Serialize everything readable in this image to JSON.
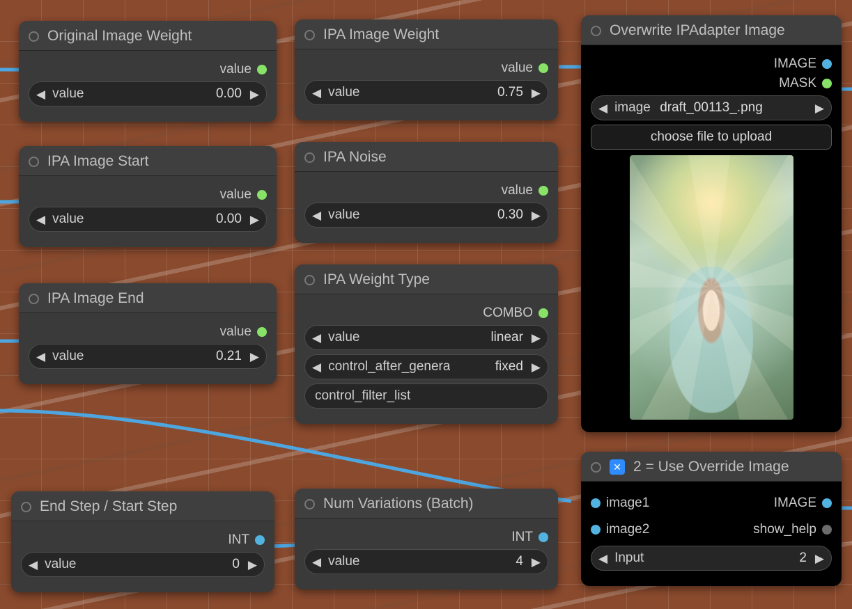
{
  "labels": {
    "value": "value",
    "INT": "INT",
    "COMBO": "COMBO",
    "IMAGE": "IMAGE",
    "MASK": "MASK",
    "choose_file": "choose file to upload",
    "image_field": "image",
    "image1": "image1",
    "image2": "image2",
    "show_help": "show_help",
    "Input": "Input"
  },
  "nodes": {
    "original_weight": {
      "title": "Original Image Weight",
      "value": "0.00"
    },
    "ipa_weight": {
      "title": "IPA Image Weight",
      "value": "0.75"
    },
    "ipa_start": {
      "title": "IPA Image Start",
      "value": "0.00"
    },
    "ipa_noise": {
      "title": "IPA Noise",
      "value": "0.30"
    },
    "ipa_end": {
      "title": "IPA Image End",
      "value": "0.21"
    },
    "ipa_wtype": {
      "title": "IPA Weight Type",
      "value": "linear",
      "cag_label": "control_after_genera",
      "cag_value": "fixed",
      "cfl": "control_filter_list"
    },
    "end_start": {
      "title": "End Step / Start Step",
      "value": "0"
    },
    "num_var": {
      "title": "Num Variations (Batch)",
      "value": "4"
    },
    "overwrite": {
      "title": "Overwrite IPAdapter Image",
      "file": "draft_00113_.png"
    },
    "use_override": {
      "title": "2 = Use Override Image",
      "input": "2"
    }
  }
}
